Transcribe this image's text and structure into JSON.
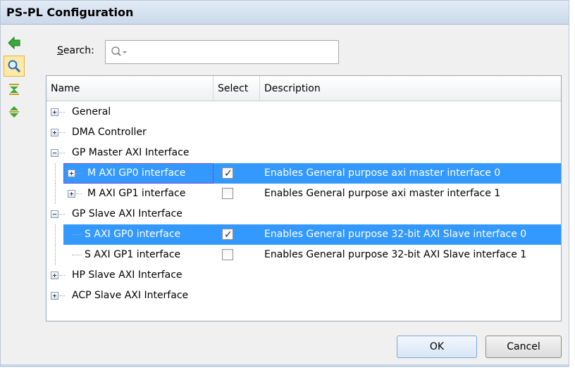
{
  "window": {
    "title": "PS-PL Configuration"
  },
  "toolbar": {
    "tools": [
      {
        "name": "back-arrow-icon"
      },
      {
        "name": "search-icon",
        "active": true
      },
      {
        "name": "collapse-all-icon"
      },
      {
        "name": "expand-all-icon"
      }
    ]
  },
  "search": {
    "label_prefix": "S",
    "label_rest": "earch:",
    "value": "",
    "placeholder": ""
  },
  "table": {
    "columns": [
      "Name",
      "Select",
      "Description"
    ],
    "rows": [
      {
        "name": "General",
        "level": 0,
        "expander": "plus",
        "select": null,
        "description": ""
      },
      {
        "name": "DMA Controller",
        "level": 0,
        "expander": "plus",
        "select": null,
        "description": ""
      },
      {
        "name": "GP Master AXI Interface",
        "level": 0,
        "expander": "minus",
        "select": null,
        "description": ""
      },
      {
        "name": "M AXI GP0 interface",
        "level": 1,
        "expander": "plus",
        "select": true,
        "description": "Enables General purpose axi master interface 0",
        "selected": true
      },
      {
        "name": "M AXI GP1 interface",
        "level": 1,
        "expander": "plus",
        "select": false,
        "description": "Enables General purpose axi master interface 1"
      },
      {
        "name": "GP Slave AXI Interface",
        "level": 0,
        "expander": "minus",
        "select": null,
        "description": ""
      },
      {
        "name": "S AXI GP0 interface",
        "level": 1,
        "expander": null,
        "select": true,
        "description": "Enables General purpose 32-bit AXI Slave interface 0",
        "selected": true
      },
      {
        "name": "S AXI GP1 interface",
        "level": 1,
        "expander": null,
        "select": false,
        "description": "Enables General purpose 32-bit AXI Slave interface 1"
      },
      {
        "name": "HP Slave AXI Interface",
        "level": 0,
        "expander": "plus",
        "select": null,
        "description": ""
      },
      {
        "name": "ACP Slave AXI Interface",
        "level": 0,
        "expander": "plus",
        "select": null,
        "description": ""
      }
    ]
  },
  "buttons": {
    "ok": "OK",
    "cancel": "Cancel"
  },
  "colors": {
    "selection": "#3399ff",
    "titlebar": "#cbd9eb",
    "accent_green": "#3aa83a"
  }
}
